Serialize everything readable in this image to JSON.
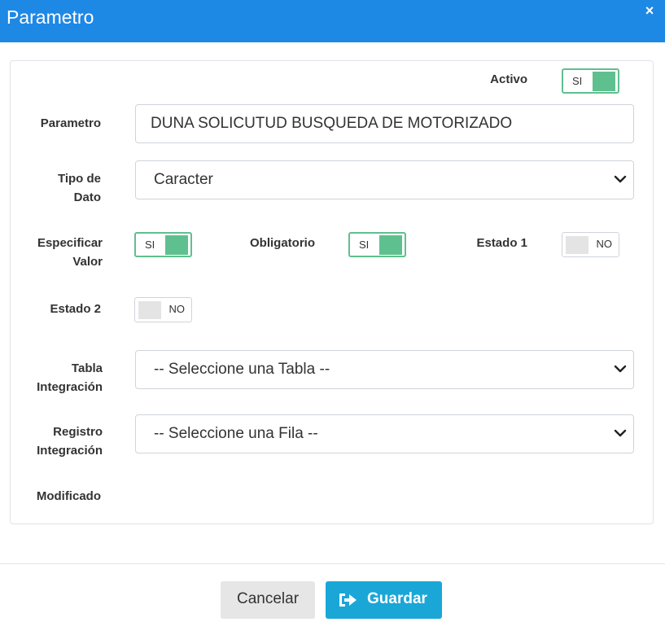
{
  "dialog": {
    "title": "Parametro",
    "close_symbol": "×",
    "header_color": "#1e88e5"
  },
  "form": {
    "activo": {
      "label": "Activo",
      "toggle": "SI"
    },
    "parametro": {
      "label": "Parametro",
      "value": "DUNA SOLICUTUD BUSQUEDA DE MOTORIZADO"
    },
    "tipo_dato": {
      "label": "Tipo de\nDato",
      "selected": "Caracter"
    },
    "especificar_valor": {
      "label": "Especificar\nValor",
      "toggle": "SI"
    },
    "obligatorio": {
      "label": "Obligatorio",
      "toggle": "SI"
    },
    "estado1": {
      "label": "Estado 1",
      "toggle": "NO"
    },
    "estado2": {
      "label": "Estado 2",
      "toggle": "NO"
    },
    "tabla_integracion": {
      "label": "Tabla\nIntegración",
      "selected": "-- Seleccione una Tabla --"
    },
    "registro_integracion": {
      "label": "Registro\nIntegración",
      "selected": "-- Seleccione una Fila --"
    },
    "modificado": {
      "label": "Modificado"
    }
  },
  "footer": {
    "cancel_label": "Cancelar",
    "save_label": "Guardar"
  },
  "colors": {
    "toggle_on": "#5fc08f",
    "save_button": "#1aa7d8"
  },
  "icons": {
    "close": "close-icon",
    "chevron": "chevron-down-icon",
    "save": "save-arrow-icon"
  }
}
